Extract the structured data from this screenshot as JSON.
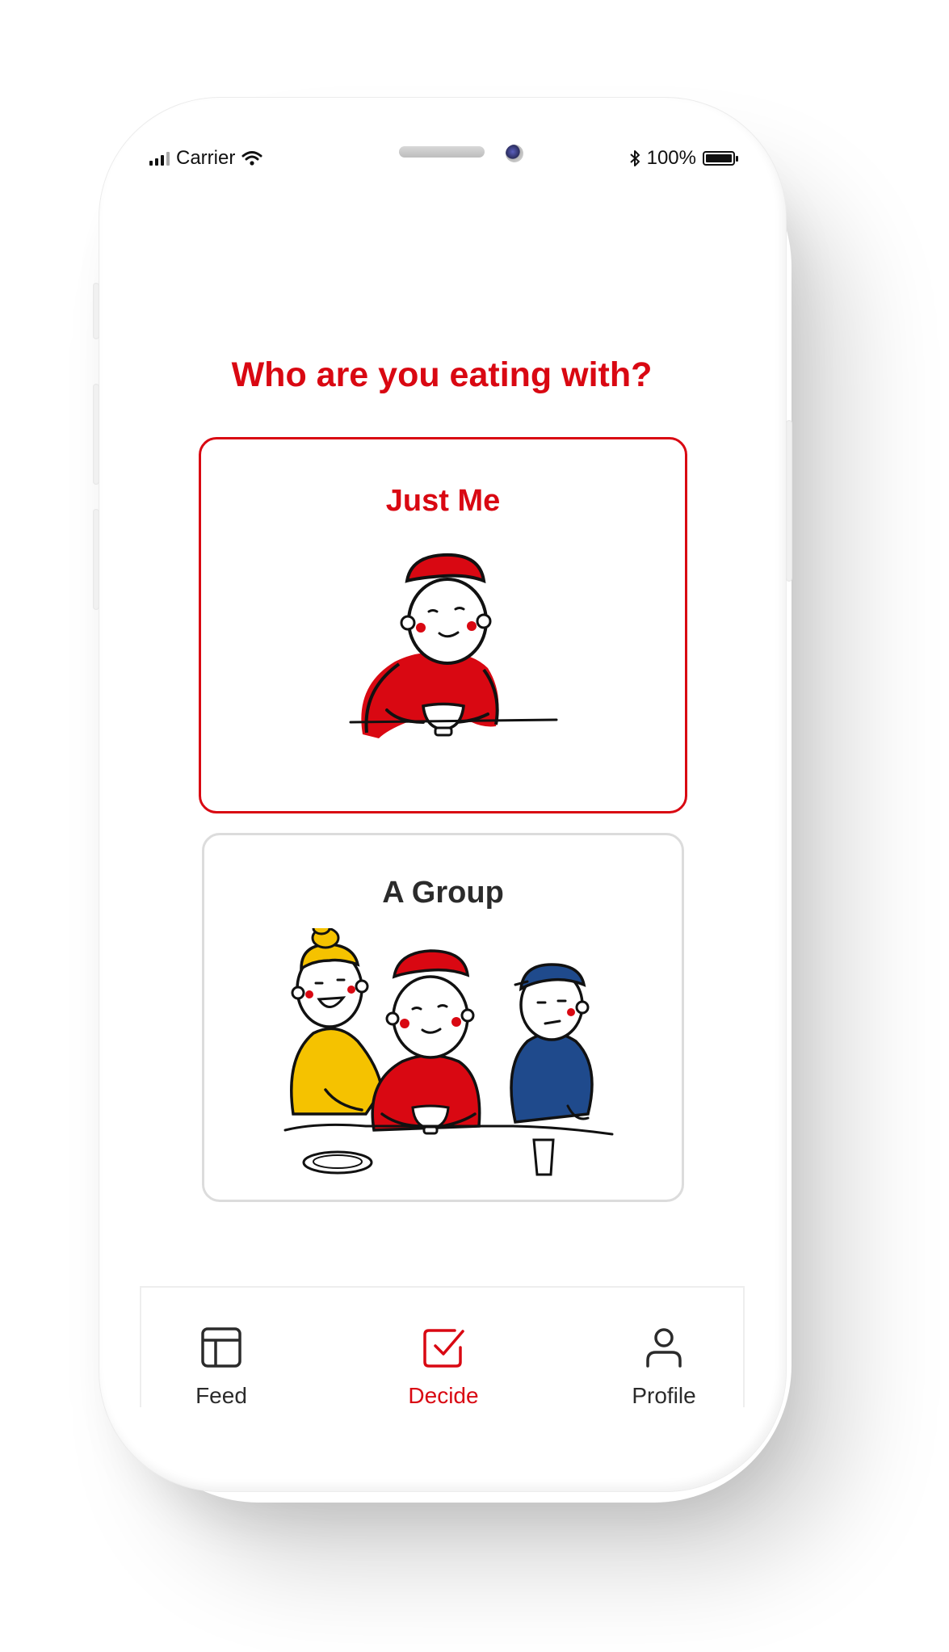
{
  "status_bar": {
    "carrier": "Carrier",
    "battery": "100%"
  },
  "question": "Who are you eating with?",
  "options": [
    {
      "label": "Just Me",
      "selected": true
    },
    {
      "label": "A Group",
      "selected": false
    }
  ],
  "tabs": [
    {
      "label": "Feed",
      "icon": "layout-icon",
      "active": false
    },
    {
      "label": "Decide",
      "icon": "checkbox-icon",
      "active": true
    },
    {
      "label": "Profile",
      "icon": "user-icon",
      "active": false
    }
  ],
  "colors": {
    "accent": "#d90812",
    "yellow": "#f5c200",
    "blue": "#1f4a8c",
    "inactive": "#2b2b2b"
  }
}
